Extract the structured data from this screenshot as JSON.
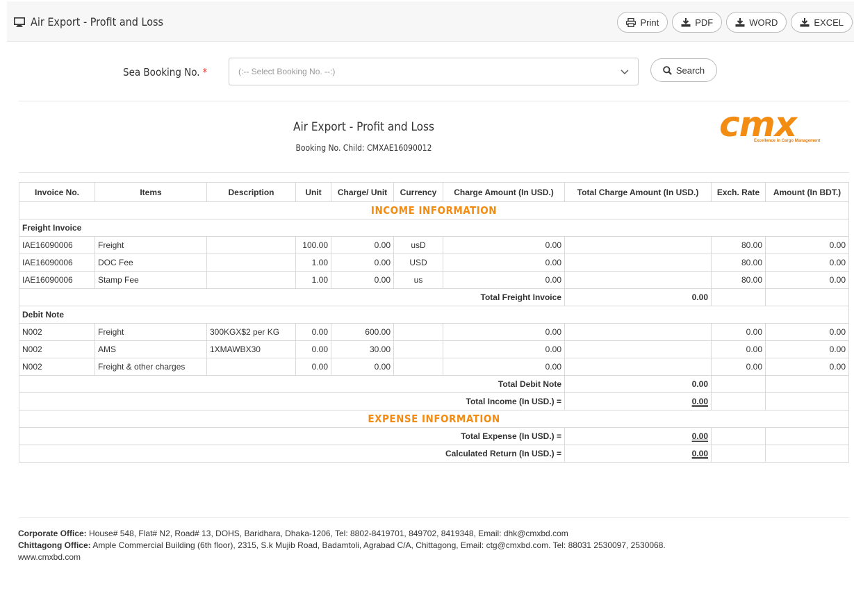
{
  "header": {
    "title": "Air Export - Profit and Loss",
    "buttons": {
      "print": "Print",
      "pdf": "PDF",
      "word": "WORD",
      "excel": "EXCEL"
    }
  },
  "form": {
    "label": "Sea Booking No.",
    "required_mark": "*",
    "select_placeholder": "(:-- Select Booking No. --:)",
    "search_label": "Search"
  },
  "report": {
    "title": "Air Export - Profit and Loss",
    "subtitle": "Booking No. Child: CMXAE16090012",
    "logo_text": "cmx",
    "logo_tagline": "Excellence in Cargo Management"
  },
  "table": {
    "columns": [
      "Invoice No.",
      "Items",
      "Description",
      "Unit",
      "Charge/ Unit",
      "Currency",
      "Charge Amount (In USD.)",
      "Total Charge Amount (In USD.)",
      "Exch. Rate",
      "Amount (In BDT.)"
    ],
    "income_heading": "INCOME INFORMATION",
    "expense_heading": "EXPENSE INFORMATION",
    "freight_group": "Freight Invoice",
    "freight_rows": [
      {
        "invoice": "IAE16090006",
        "item": "Freight",
        "desc": "",
        "unit": "100.00",
        "charge_unit": "0.00",
        "currency": "usD",
        "charge_amount": "0.00",
        "total_charge": "",
        "exch": "80.00",
        "amount": "0.00"
      },
      {
        "invoice": "IAE16090006",
        "item": "DOC Fee",
        "desc": "",
        "unit": "1.00",
        "charge_unit": "0.00",
        "currency": "USD",
        "charge_amount": "0.00",
        "total_charge": "",
        "exch": "80.00",
        "amount": "0.00"
      },
      {
        "invoice": "IAE16090006",
        "item": "Stamp Fee",
        "desc": "",
        "unit": "1.00",
        "charge_unit": "0.00",
        "currency": "us",
        "charge_amount": "0.00",
        "total_charge": "",
        "exch": "80.00",
        "amount": "0.00"
      }
    ],
    "total_freight_label": "Total Freight Invoice",
    "total_freight_value": "0.00",
    "debit_group": "Debit Note",
    "debit_rows": [
      {
        "invoice": "N002",
        "item": "Freight",
        "desc": "300KGX$2 per KG",
        "unit": "0.00",
        "charge_unit": "600.00",
        "currency": "",
        "charge_amount": "0.00",
        "total_charge": "",
        "exch": "0.00",
        "amount": "0.00"
      },
      {
        "invoice": "N002",
        "item": "AMS",
        "desc": "1XMAWBX30",
        "unit": "0.00",
        "charge_unit": "30.00",
        "currency": "",
        "charge_amount": "0.00",
        "total_charge": "",
        "exch": "0.00",
        "amount": "0.00"
      },
      {
        "invoice": "N002",
        "item": "Freight & other charges",
        "desc": "",
        "unit": "0.00",
        "charge_unit": "0.00",
        "currency": "",
        "charge_amount": "0.00",
        "total_charge": "",
        "exch": "0.00",
        "amount": "0.00"
      }
    ],
    "total_debit_label": "Total Debit Note",
    "total_debit_value": "0.00",
    "total_income_label": "Total Income (In USD.) =",
    "total_income_value": "0.00",
    "total_expense_label": "Total Expense (In USD.) =",
    "total_expense_value": "0.00",
    "calc_return_label": "Calculated Return (In USD.) =",
    "calc_return_value": "0.00"
  },
  "footer": {
    "corporate_label": "Corporate Office:",
    "corporate_text": " House# 548, Flat# N2, Road# 13, DOHS, Baridhara, Dhaka-1206, Tel: 8802-8419701, 849702, 8419348, Email: dhk@cmxbd.com",
    "chittagong_label": "Chittagong Office:",
    "chittagong_text": " Ample Commercial Building (6th floor), 2315, S.k Mujib Road, Badamtoli, Agrabad C/A, Chittagong, Email: ctg@cmxbd.com. Tel: 88031 2530097, 2530068.",
    "website": "www.cmxbd.com"
  },
  "colors": {
    "accent": "#f28c12",
    "required": "#e53935"
  }
}
